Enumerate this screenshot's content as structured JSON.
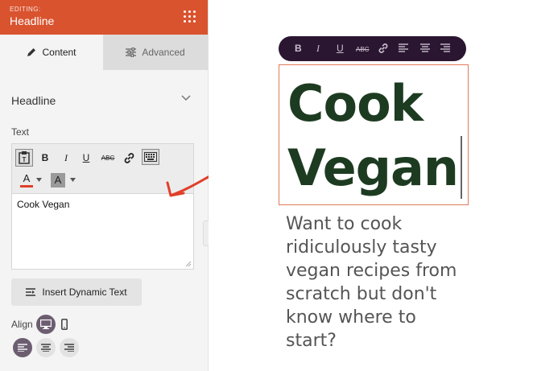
{
  "header": {
    "editing_label": "EDITING:",
    "title": "Headline"
  },
  "tabs": [
    {
      "label": "Content"
    },
    {
      "label": "Advanced"
    }
  ],
  "section": {
    "title": "Headline"
  },
  "text_field": {
    "label": "Text",
    "value": "Cook Vegan"
  },
  "toolbar": {
    "bold": "B",
    "italic": "I",
    "underline": "U",
    "strike": "ABC",
    "font_color": "A",
    "bg_color": "A"
  },
  "insert_button": {
    "label": "Insert Dynamic Text"
  },
  "align": {
    "label": "Align"
  },
  "floating_toolbar": {
    "bold": "B",
    "italic": "I",
    "underline": "U",
    "strike": "ABC"
  },
  "canvas": {
    "headline_line1": "Cook",
    "headline_line2": "Vegan",
    "paragraph": [
      "Want to cook",
      "ridiculously tasty",
      "vegan recipes from",
      "scratch but don't",
      "know where to",
      "start?"
    ]
  },
  "colors": {
    "header": "#d9532f",
    "headline": "#1d3b21",
    "float_toolbar": "#2b1631",
    "arrow": "#e0402a"
  }
}
